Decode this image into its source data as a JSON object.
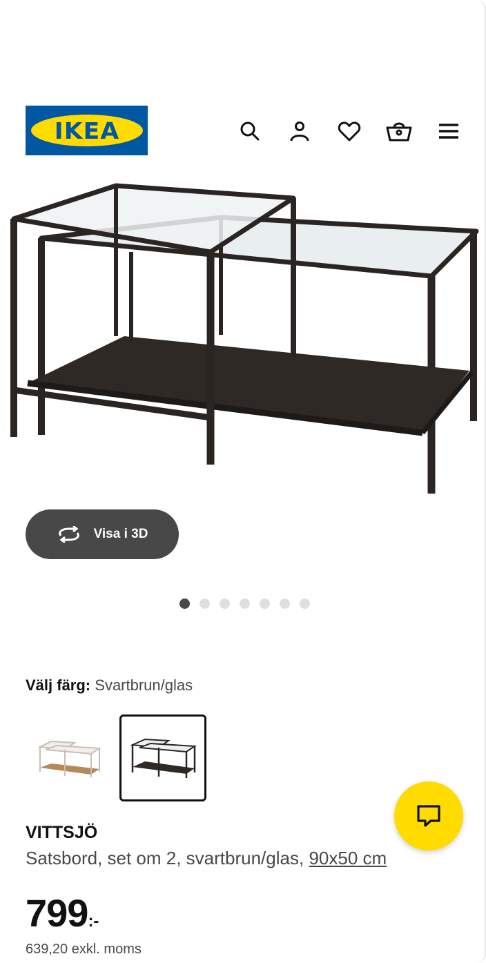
{
  "header": {
    "logo_text": "IKEA",
    "icons": [
      "search-icon",
      "account-icon",
      "heart-icon",
      "basket-icon",
      "menu-icon"
    ]
  },
  "gallery": {
    "view_3d_label": "Visa i 3D",
    "slide_count": 7,
    "active_slide": 1
  },
  "color": {
    "label": "Välj färg:",
    "value": "Svartbrun/glas",
    "options": [
      "white-stained-oak-glass",
      "black-brown-glass"
    ],
    "selected_index": 1
  },
  "product": {
    "name": "VITTSJÖ",
    "description": "Satsbord, set om 2, svartbrun/glas,",
    "size_link": "90x50 cm",
    "price_integer": "799",
    "price_suffix": ":-",
    "price_excl_vat": "639,20 exkl. moms"
  },
  "colors": {
    "ikea_blue": "#0058a3",
    "ikea_yellow": "#ffdb00",
    "button_dark": "#484848"
  }
}
